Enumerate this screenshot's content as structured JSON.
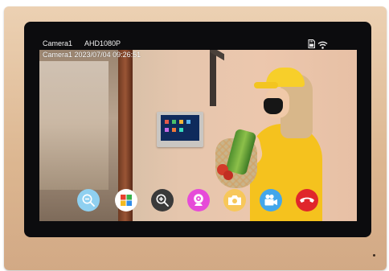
{
  "status_bar": {
    "camera_label": "Camera1",
    "resolution": "AHD1080P",
    "icons": [
      "sd-card-icon",
      "wifi-icon"
    ]
  },
  "overlay": {
    "camera_name": "Camera1",
    "date": "2023/07/04",
    "time": "09:26:51"
  },
  "controls": [
    {
      "name": "zoom-out",
      "icon": "zoom-out-icon",
      "color": "#8fd0f0"
    },
    {
      "name": "color-settings",
      "icon": "color-grid-icon",
      "color": "#ffffff"
    },
    {
      "name": "zoom-in",
      "icon": "zoom-in-icon",
      "color": "#3a3a3a"
    },
    {
      "name": "record",
      "icon": "webcam-icon",
      "color": "#e64bd8"
    },
    {
      "name": "snapshot",
      "icon": "camera-icon",
      "color": "#f7c75a"
    },
    {
      "name": "video",
      "icon": "video-camera-icon",
      "color": "#43a6ea"
    },
    {
      "name": "hang-up",
      "icon": "phone-hangup-icon",
      "color": "#e0262b"
    }
  ],
  "colors": {
    "frame": "#dcb690",
    "bezel": "#0c0c0e"
  }
}
